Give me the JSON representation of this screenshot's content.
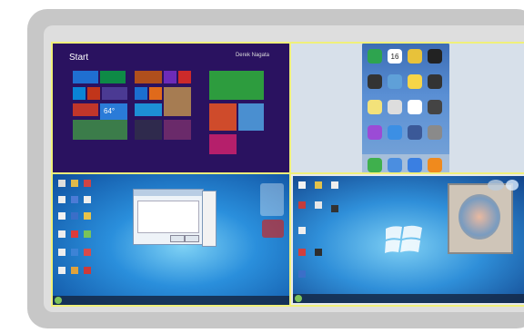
{
  "screens": {
    "win8": {
      "start_label": "Start",
      "user_label": "Derek Nagata",
      "weather_temp": "64°"
    },
    "ios": {
      "calendar_day": "16"
    }
  },
  "colors": {
    "outer_frame": "#c7c7c7",
    "inner_panel": "#dedede",
    "cell_border": "#f0f07a",
    "win8_bg": "#2a1260"
  }
}
